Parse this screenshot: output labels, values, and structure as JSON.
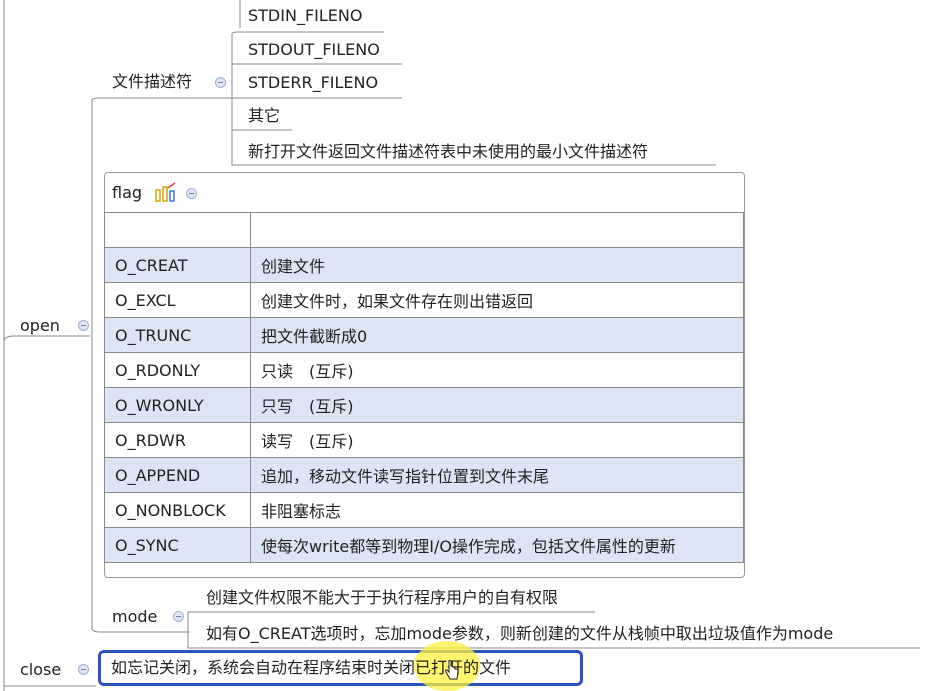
{
  "left_nodes": {
    "open": "open",
    "close": "close"
  },
  "fd": {
    "label": "文件描述符",
    "items": [
      "STDIN_FILENO",
      "STDOUT_FILENO",
      "STDERR_FILENO",
      "其它",
      "新打开文件返回文件描述符表中未使用的最小文件描述符"
    ]
  },
  "flag": {
    "label": "flag",
    "rows": [
      {
        "k": "",
        "v": ""
      },
      {
        "k": "O_CREAT",
        "v": "创建文件"
      },
      {
        "k": "O_EXCL",
        "v": "创建文件时，如果文件存在则出错返回"
      },
      {
        "k": "O_TRUNC",
        "v": "把文件截断成0"
      },
      {
        "k": "O_RDONLY",
        "v": "只读　(互斥)"
      },
      {
        "k": "O_WRONLY",
        "v": "只写　(互斥)"
      },
      {
        "k": "O_RDWR",
        "v": "读写　(互斥)"
      },
      {
        "k": "O_APPEND",
        "v": "追加，移动文件读写指针位置到文件末尾"
      },
      {
        "k": "O_NONBLOCK",
        "v": "非阻塞标志"
      },
      {
        "k": "O_SYNC",
        "v": "使每次write都等到物理I/O操作完成，包括文件属性的更新"
      }
    ]
  },
  "mode": {
    "label": "mode",
    "items": [
      "创建文件权限不能大于于执行程序用户的自有权限",
      "如有O_CREAT选项时，忘加mode参数，则新创建的文件从栈帧中取出垃圾值作为mode"
    ]
  },
  "close_note": "如忘记关闭，系统会自动在程序结束时关闭已打开的文件",
  "colors": {
    "accent": "#2a55b8",
    "row_alt": "#dce5f6",
    "cursor_highlight": "#fff03c"
  }
}
